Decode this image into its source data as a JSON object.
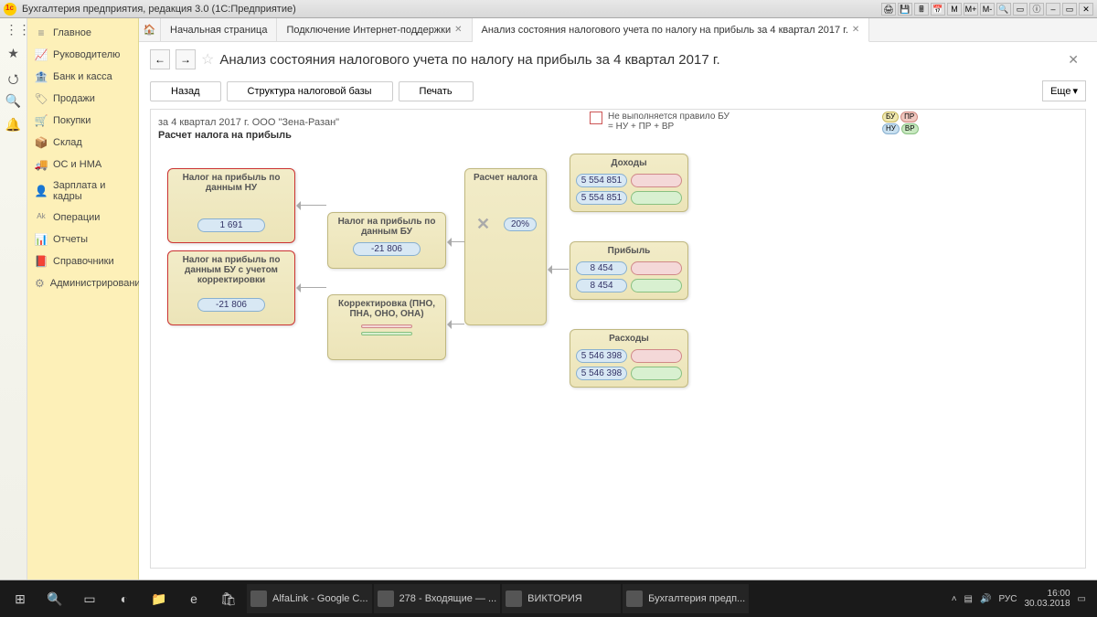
{
  "window": {
    "title": "Бухгалтерия предприятия, редакция 3.0  (1С:Предприятие)"
  },
  "sidebar": {
    "items": [
      {
        "icon": "≡",
        "label": "Главное"
      },
      {
        "icon": "📈",
        "label": "Руководителю"
      },
      {
        "icon": "🏦",
        "label": "Банк и касса"
      },
      {
        "icon": "🏷",
        "label": "Продажи"
      },
      {
        "icon": "🛒",
        "label": "Покупки"
      },
      {
        "icon": "📦",
        "label": "Склад"
      },
      {
        "icon": "🚚",
        "label": "ОС и НМА"
      },
      {
        "icon": "👤",
        "label": "Зарплата и кадры"
      },
      {
        "icon": "ᴬᵏ",
        "label": "Операции"
      },
      {
        "icon": "📊",
        "label": "Отчеты"
      },
      {
        "icon": "📕",
        "label": "Справочники"
      },
      {
        "icon": "⚙",
        "label": "Администрирование"
      }
    ]
  },
  "tabs": {
    "home": "Начальная страница",
    "t1": "Подключение Интернет-поддержки",
    "t2": "Анализ состояния налогового учета по налогу на прибыль за 4 квартал 2017 г."
  },
  "page": {
    "title": "Анализ состояния налогового учета по налогу на прибыль за 4 квартал 2017 г.",
    "period": "за 4 квартал 2017 г. ООО \"Зена-Разан\"",
    "subtitle": "Расчет налога на прибыль"
  },
  "toolbar": {
    "back": "Назад",
    "structure": "Структура налоговой базы",
    "print": "Печать",
    "more": "Еще"
  },
  "legend": {
    "rule": "Не выполняется правило БУ = НУ + ПР + ВР",
    "b1": "БУ",
    "b2": "ПР",
    "b3": "НУ",
    "b4": "ВР"
  },
  "blocks": {
    "nu": {
      "title": "Налог на прибыль по данным НУ",
      "val": "1 691"
    },
    "bu_corr": {
      "title": "Налог на прибыль по данным БУ с учетом корректировки",
      "val": "-21 806"
    },
    "bu": {
      "title": "Налог на прибыль по данным БУ",
      "val": "-21 806"
    },
    "corr": {
      "title": "Корректировка (ПНО, ПНА, ОНО, ОНА)"
    },
    "calc": {
      "title": "Расчет налога",
      "rate": "20%"
    },
    "income": {
      "title": "Доходы",
      "v1": "5 554 851",
      "v2": "5 554 851"
    },
    "profit": {
      "title": "Прибыль",
      "v1": "8 454",
      "v2": "8 454"
    },
    "expense": {
      "title": "Расходы",
      "v1": "5 546 398",
      "v2": "5 546 398"
    }
  },
  "taskbar": {
    "items": [
      {
        "label": "AlfaLink - Google C..."
      },
      {
        "label": "278 - Входящие — ..."
      },
      {
        "label": "ВИКТОРИЯ"
      },
      {
        "label": "Бухгалтерия предп..."
      }
    ],
    "lang": "РУС",
    "time": "16:00",
    "date": "30.03.2018"
  }
}
